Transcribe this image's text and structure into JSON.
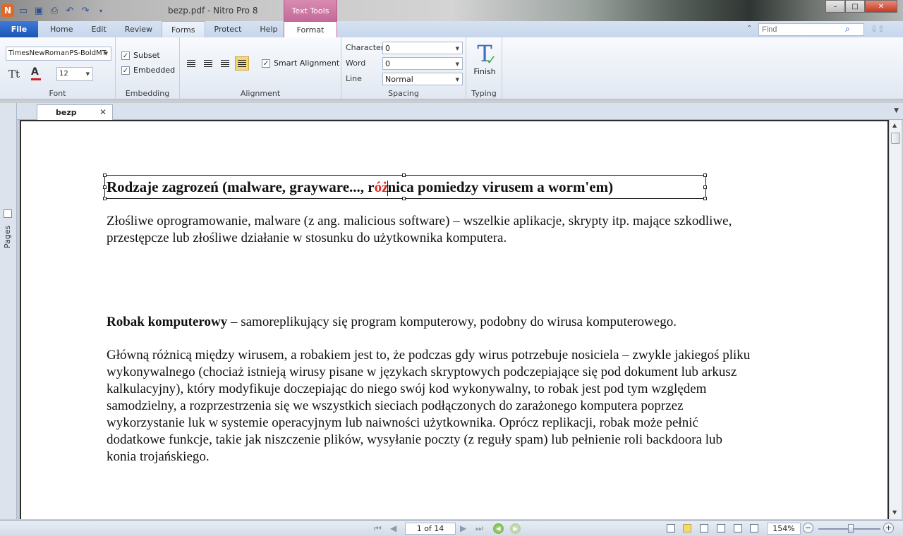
{
  "window": {
    "title": "bezp.pdf - Nitro Pro 8",
    "context_tab_group": "Text Tools",
    "controls": {
      "minimize": "–",
      "maximize": "□",
      "close": "✕"
    }
  },
  "ribbon_tabs": {
    "file": "File",
    "items": [
      "Home",
      "Edit",
      "Review",
      "Forms",
      "Protect",
      "Help"
    ],
    "active": "Format"
  },
  "find": {
    "placeholder": "Find"
  },
  "font_group": {
    "font_name": "TimesNewRomanPS-BoldMT",
    "font_size": "12",
    "label": "Font"
  },
  "embedding_group": {
    "subset": "Subset",
    "embedded": "Embedded",
    "label": "Embedding"
  },
  "alignment_group": {
    "smart_alignment": "Smart Alignment",
    "label": "Alignment",
    "active_alignment": "justify"
  },
  "spacing_group": {
    "character_label": "Character",
    "character_value": "0",
    "word_label": "Word",
    "word_value": "0",
    "line_label": "Line",
    "line_value": "Normal",
    "label": "Spacing"
  },
  "typing_group": {
    "finish": "Finish",
    "label": "Typing"
  },
  "side_panel": {
    "pages": "Pages"
  },
  "doc_tab": {
    "name": "bezp"
  },
  "document": {
    "heading_before": "Rodzaje zagrozeń (malware, grayware..., r",
    "heading_selected": "óż",
    "heading_after": "nica pomiedzy virusem a worm'em)",
    "para1_line1": "Złośliwe oprogramowanie, malware (z ang. malicious software) – wszelkie aplikacje, skrypty itp. mające szkodliwe,",
    "para1_line2": "przestępcze lub złośliwe działanie w stosunku do użytkownika komputera.",
    "para2_bold": "Robak komputerowy",
    "para2_rest": " – samoreplikujący się program komputerowy, podobny do wirusa komputerowego.",
    "para3_lines": [
      "Główną różnicą między wirusem, a robakiem jest to, że podczas gdy wirus potrzebuje nosiciela – zwykle jakiegoś pliku",
      "wykonywalnego (chociaż istnieją wirusy pisane w językach skryptowych podczepiające się pod dokument lub arkusz",
      "kalkulacyjny), który modyfikuje doczepiając do niego swój kod wykonywalny, to robak jest pod tym względem",
      "samodzielny, a rozprzestrzenia się we wszystkich sieciach podłączonych do zarażonego komputera poprzez",
      "wykorzystanie luk w systemie operacyjnym lub naiwności użytkownika. Oprócz replikacji, robak może pełnić",
      "dodatkowe funkcje, takie jak niszczenie plików, wysyłanie poczty (z reguły spam) lub pełnienie roli backdoora lub",
      "konia trojańskiego."
    ]
  },
  "status": {
    "page": "1 of 14",
    "zoom": "154%",
    "zoom_slider_fraction": 0.5
  },
  "colors": {
    "selection_text": "#e0271f",
    "file_tab": "#1b56b6",
    "context_tab": "#c36a9a"
  }
}
